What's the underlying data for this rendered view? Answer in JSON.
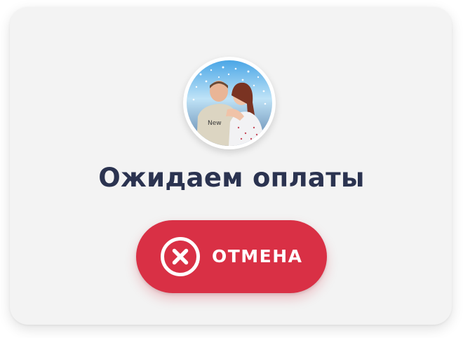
{
  "dialog": {
    "title": "Ожидаем оплаты",
    "avatar_icon": "user-photo",
    "cancel_label": "ОТМЕНА",
    "cancel_icon": "close-circle-icon"
  },
  "colors": {
    "card_background": "#f3f3f3",
    "title_text": "#2b3350",
    "cancel_button": "#d93045",
    "cancel_text": "#ffffff"
  }
}
